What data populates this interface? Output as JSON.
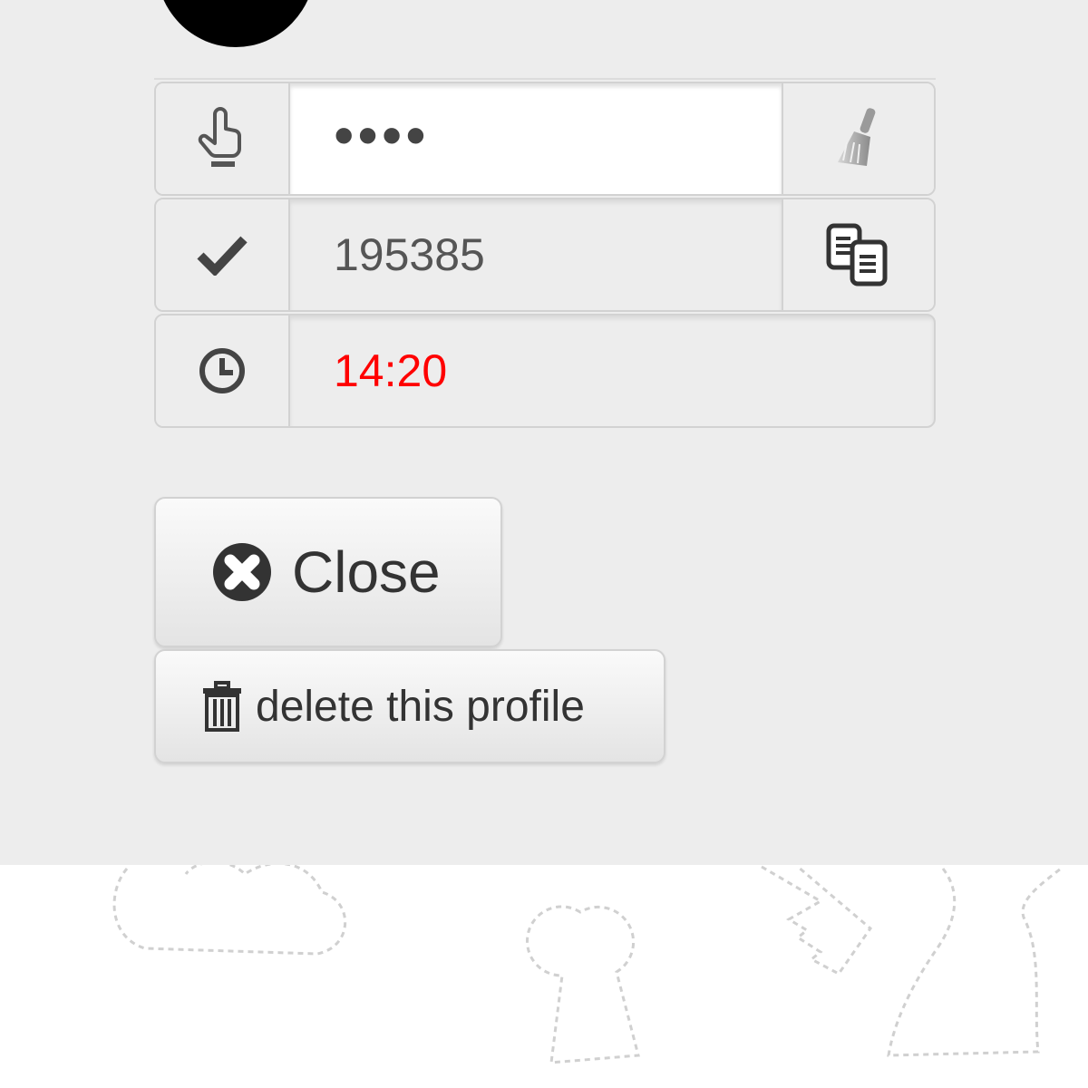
{
  "profile": {
    "avatar_icon": "user-avatar"
  },
  "fields": {
    "pin": {
      "icon": "touch-icon",
      "value": "••••",
      "action_icon": "broom-icon"
    },
    "code": {
      "icon": "checkmark-icon",
      "value": "195385",
      "action_icon": "copy-icon"
    },
    "timer": {
      "icon": "clock-icon",
      "value": "14:20",
      "color": "#ff0000"
    }
  },
  "buttons": {
    "close_label": "Close",
    "delete_label": "delete this profile"
  },
  "colors": {
    "panel_bg": "#ededed",
    "timer_text": "#ff0000"
  }
}
